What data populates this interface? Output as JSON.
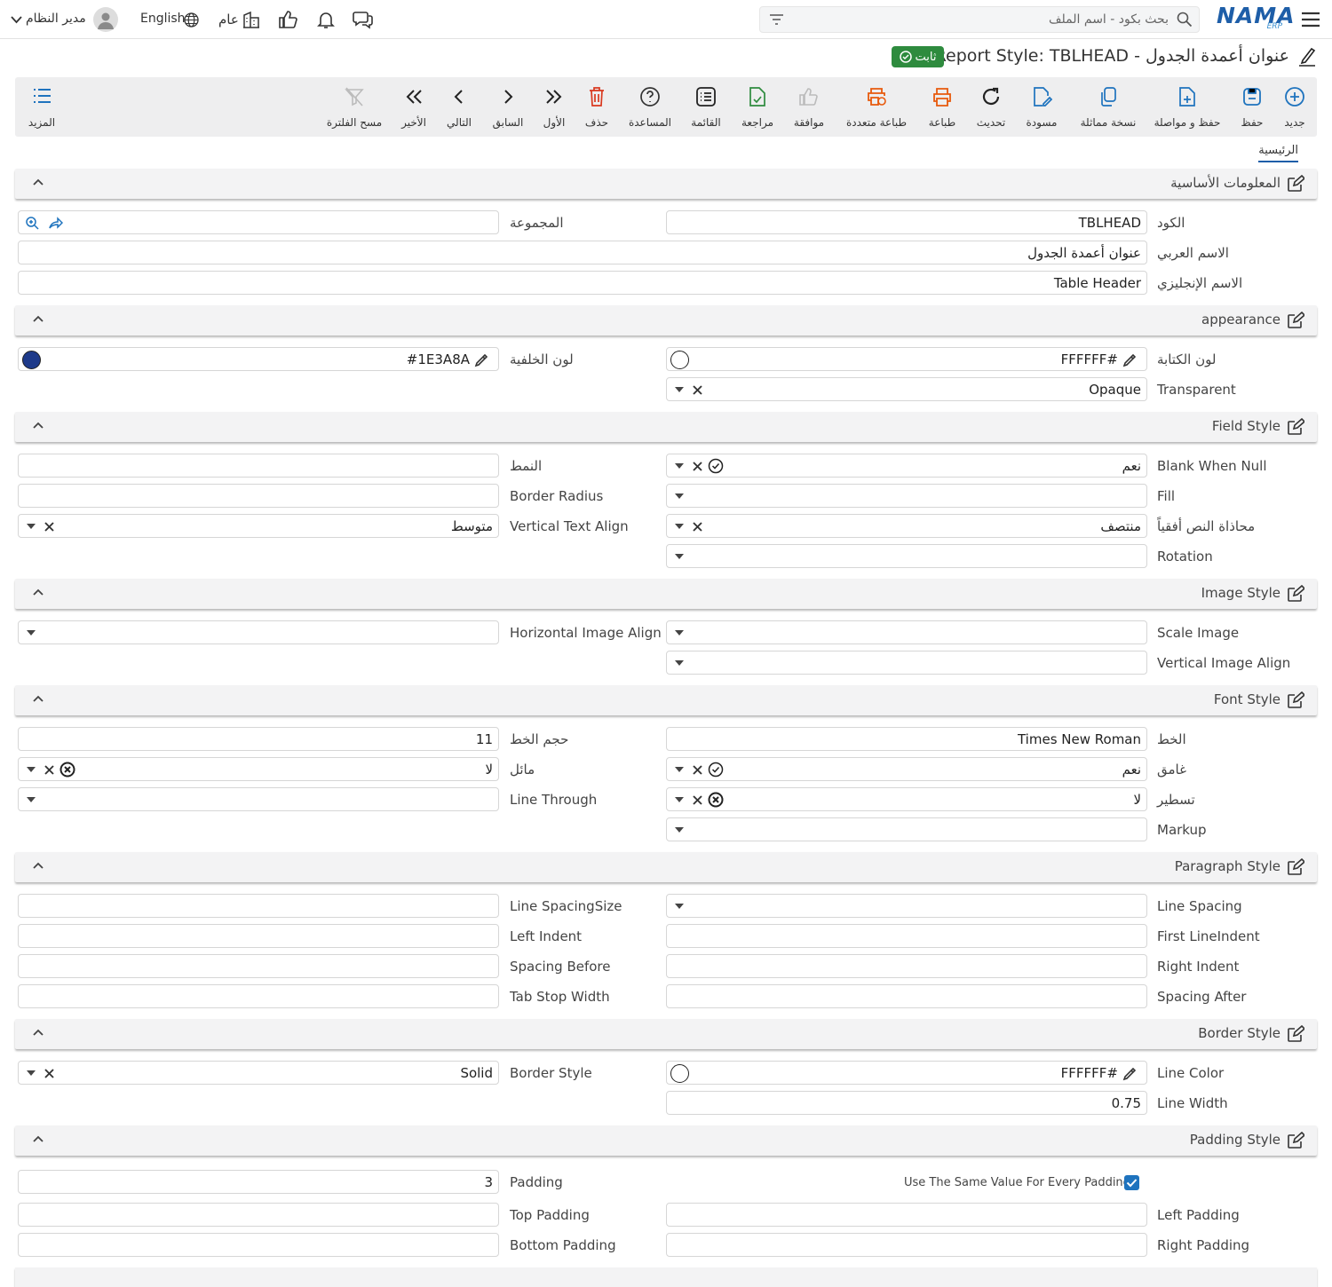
{
  "topbar": {
    "search_placeholder": "بحث بكود - اسم الملف",
    "user": "مدير النظام",
    "language": "English",
    "branch": "عام",
    "brand": "NAMA",
    "brand_sub": "ERP"
  },
  "page": {
    "title": "عنوان أعمدة الجدول - Report Style: TBLHEAD",
    "status": "ثابت"
  },
  "toolbar": {
    "new": "جديد",
    "save": "حفظ",
    "save_continue": "حفظ و مواصلة",
    "copy": "نسخة مماثلة",
    "draft": "مسودة",
    "refresh": "تحديث",
    "print": "طباعة",
    "multi_print": "طباعة متعددة",
    "approve": "موافقة",
    "review": "مراجعة",
    "list": "القائمة",
    "help": "المساعدة",
    "delete": "حذف",
    "first": "الأول",
    "prev": "السابق",
    "next": "التالي",
    "last": "الأخير",
    "clear_filter": "مسح الفلترة",
    "more": "المزيد"
  },
  "tabs": {
    "main": "الرئيسية"
  },
  "sections": {
    "basic": "المعلومات الأساسية",
    "appearance": "appearance",
    "field_style": "Field Style",
    "image_style": "Image Style",
    "font_style": "Font Style",
    "paragraph_style": "Paragraph Style",
    "border_style": "Border Style",
    "padding_style": "Padding Style"
  },
  "labels": {
    "code": "الكود",
    "group": "المجموعة",
    "arabic_name": "الاسم العربي",
    "english_name": "الاسم الإنجليزي",
    "fore_color": "لون الكتابة",
    "back_color": "لون الخلفية",
    "transparent": "Transparent",
    "blank_when_null": "Blank When Null",
    "pattern": "النمط",
    "fill": "Fill",
    "border_radius": "Border Radius",
    "h_text_align": "محاذاة النص أفقياً",
    "v_text_align": "Vertical Text Align",
    "rotation": "Rotation",
    "scale_image": "Scale Image",
    "h_image_align": "Horizontal Image Align",
    "v_image_align": "Vertical Image Align",
    "font": "الخط",
    "font_size": "حجم الخط",
    "bold": "غامق",
    "italic": "مائل",
    "underline": "تسطير",
    "line_through": "Line Through",
    "markup": "Markup",
    "line_spacing": "Line Spacing",
    "line_spacing_size": "Line SpacingSize",
    "first_line_indent": "First LineIndent",
    "left_indent": "Left Indent",
    "right_indent": "Right Indent",
    "spacing_before": "Spacing Before",
    "spacing_after": "Spacing After",
    "tab_stop_width": "Tab Stop Width",
    "line_color": "Line Color",
    "border_style": "Border Style",
    "line_width": "Line Width",
    "same_padding": "Use The Same Value For Every Padding",
    "padding": "Padding",
    "left_padding": "Left Padding",
    "top_padding": "Top Padding",
    "right_padding": "Right Padding",
    "bottom_padding": "Bottom Padding"
  },
  "values": {
    "code": "TBLHEAD",
    "arabic_name": "عنوان أعمدة الجدول",
    "english_name": "Table Header",
    "fore_color": "FFFFFF#",
    "back_color": "#1E3A8A",
    "transparent": "Opaque",
    "blank_when_null": "نعم",
    "h_text_align": "منتصف",
    "v_text_align": "متوسط",
    "font": "Times New Roman",
    "font_size": "11",
    "bold": "نعم",
    "italic": "لا",
    "underline": "لا",
    "line_color": "FFFFFF#",
    "border_style": "Solid",
    "line_width": "0.75",
    "padding": "3"
  },
  "colors": {
    "accent": "#1e5ea8",
    "status": "#2e8b3e",
    "back_swatch": "#1E3A8A",
    "fore_swatch": "#FFFFFF",
    "brand": "#1e5ea8"
  }
}
